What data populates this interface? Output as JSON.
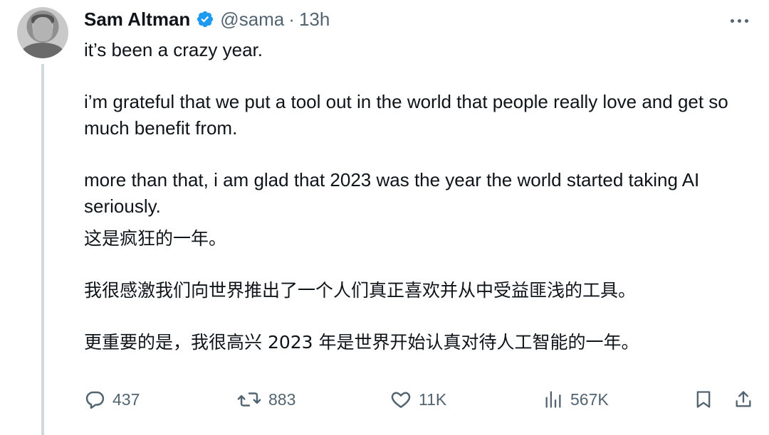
{
  "author": {
    "display_name": "Sam Altman",
    "handle": "@sama",
    "separator": "·",
    "time": "13h",
    "verified_color": "#1d9bf0"
  },
  "tweet": {
    "paragraphs": [
      "it’s been a crazy year.",
      "i’m grateful that we put a tool out in the world that people really love and get so much benefit from.",
      "more than that, i am glad that 2023 was the year the world started taking AI seriously.",
      "这是疯狂的一年。",
      "我很感激我们向世界推出了一个人们真正喜欢并从中受益匪浅的工具。",
      "更重要的是，我很高兴 2023 年是世界开始认真对待人工智能的一年。"
    ]
  },
  "actions": {
    "replies": "437",
    "reposts": "883",
    "likes": "11K",
    "views": "567K"
  },
  "icons": {
    "more": "more-icon",
    "reply": "reply-icon",
    "repost": "repost-icon",
    "like": "heart-icon",
    "views": "views-icon",
    "bookmark": "bookmark-icon",
    "share": "share-icon"
  },
  "colors": {
    "text_primary": "#0f1419",
    "text_secondary": "#536471",
    "thread_line": "#cfd9de"
  }
}
